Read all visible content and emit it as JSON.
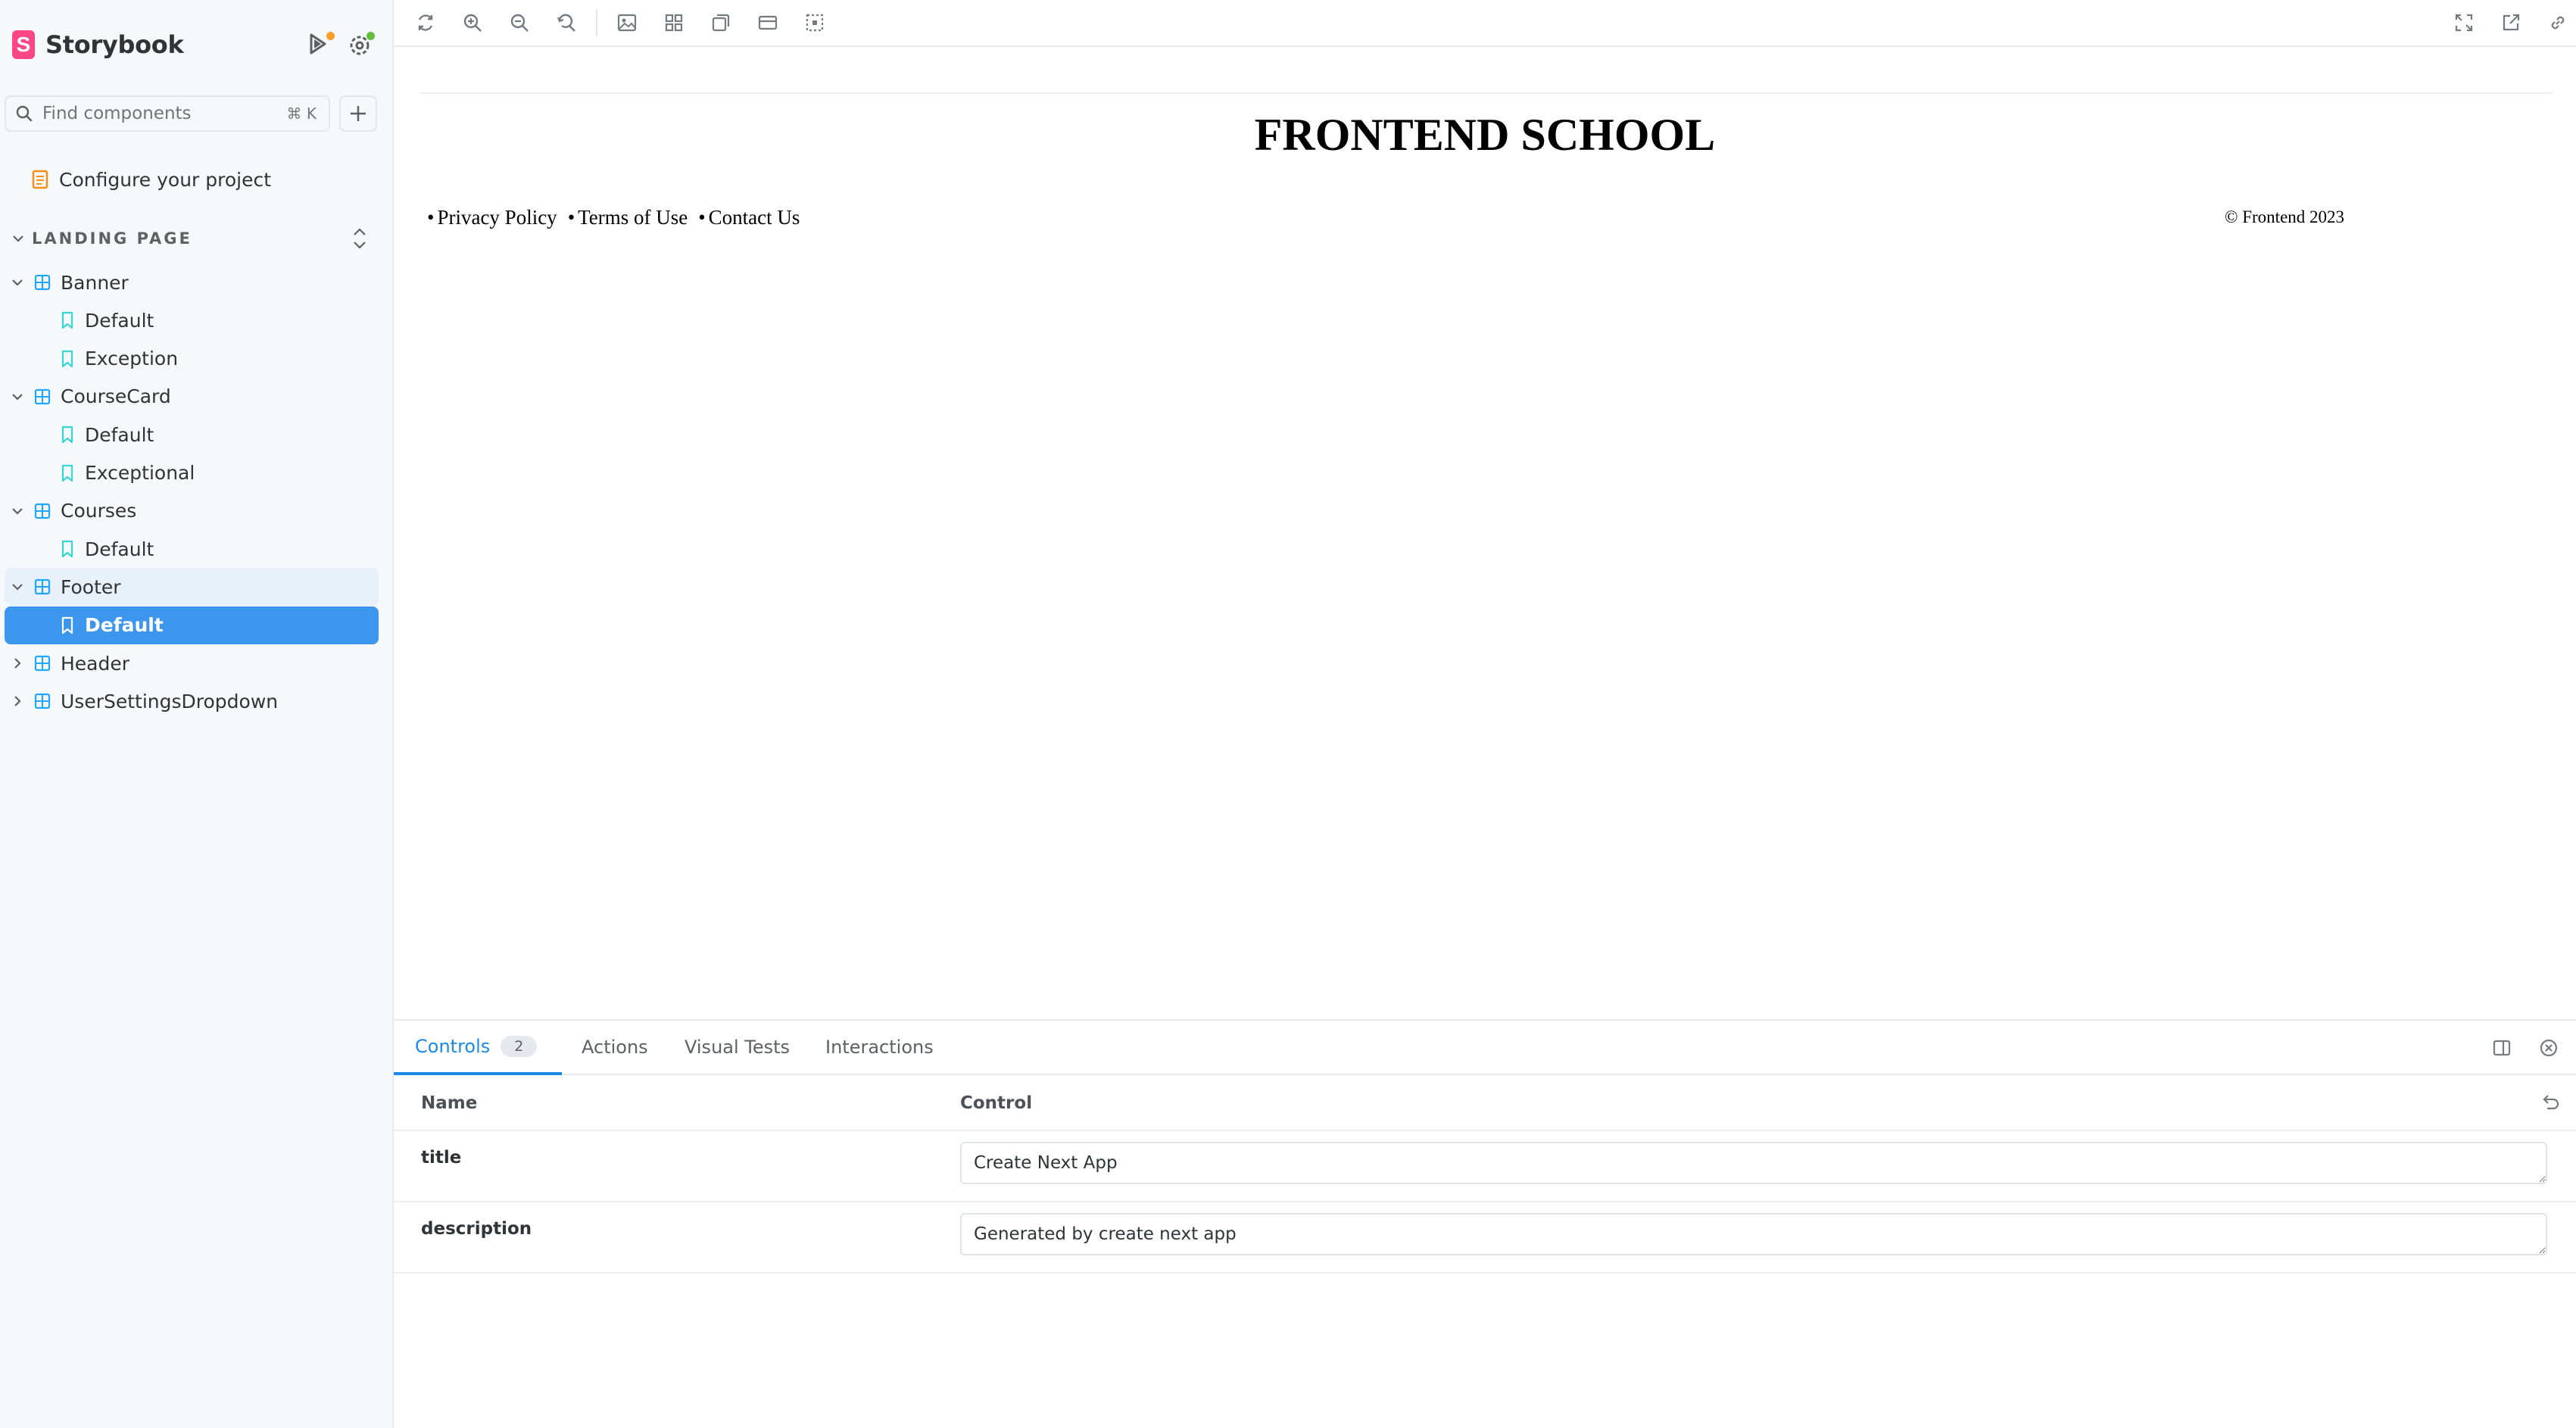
{
  "sidebar": {
    "brand": {
      "name": "Storybook"
    },
    "search": {
      "placeholder": "Find components",
      "shortcut": "⌘ K"
    },
    "configure_label": "Configure your project",
    "group": {
      "label": "LANDING PAGE"
    },
    "items": [
      {
        "label": "Banner",
        "kind": "component"
      },
      {
        "label": "Default",
        "kind": "story"
      },
      {
        "label": "Exception",
        "kind": "story"
      },
      {
        "label": "CourseCard",
        "kind": "component"
      },
      {
        "label": "Default",
        "kind": "story"
      },
      {
        "label": "Exceptional",
        "kind": "story"
      },
      {
        "label": "Courses",
        "kind": "component"
      },
      {
        "label": "Default",
        "kind": "story"
      },
      {
        "label": "Footer",
        "kind": "component"
      },
      {
        "label": "Default",
        "kind": "story",
        "selected": true
      },
      {
        "label": "Header",
        "kind": "component"
      },
      {
        "label": "UserSettingsDropdown",
        "kind": "component"
      }
    ]
  },
  "preview": {
    "site_title": "FRONTEND SCHOOL",
    "footer_links": [
      "Privacy Policy",
      "Terms of Use",
      "Contact Us"
    ],
    "bullet": "•",
    "copyright": "© Frontend 2023"
  },
  "addons": {
    "tabs": [
      {
        "label": "Controls",
        "badge": "2"
      },
      {
        "label": "Actions"
      },
      {
        "label": "Visual Tests"
      },
      {
        "label": "Interactions"
      }
    ],
    "controls": {
      "header": {
        "name": "Name",
        "control": "Control"
      },
      "rows": [
        {
          "name": "title",
          "value": "Create Next App"
        },
        {
          "name": "description",
          "value": "Generated by create next app"
        }
      ]
    }
  },
  "colors": {
    "brand": "#ff4785",
    "accent": "#1e88e5",
    "selected_bg": "#3d96ee",
    "component_icon": "#1ea7fd",
    "story_icon": "#37d5d3",
    "docs_icon": "#ff8c1a"
  }
}
